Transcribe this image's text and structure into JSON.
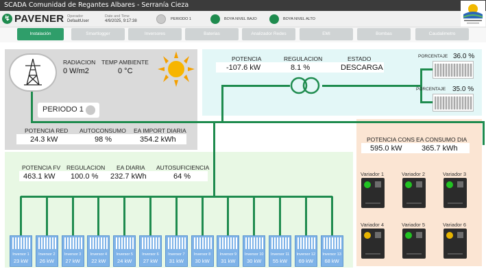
{
  "window_title": "SCADA Comunidad de Regantes Albares - Serranía Cieza",
  "logo": "PAVENER",
  "operator": {
    "label": "Operador",
    "value": "DefaultUser"
  },
  "datetime": {
    "label": "Date and Time",
    "value": "4/9/2025, 9:17:38"
  },
  "indicators": [
    {
      "label": "PERIODO 1",
      "color": "#c9c9c9"
    },
    {
      "label": "BOYA NIVEL BAJO",
      "color": "#1e8b4e"
    },
    {
      "label": "BOYA NIVEL ALTO",
      "color": "#1e8b4e"
    }
  ],
  "tabs": [
    "Instalación",
    "Smartlogger",
    "Inversores",
    "Baterias",
    "Analizador Redes",
    "EMI",
    "Bombas",
    "Caudalimetro"
  ],
  "weather": {
    "rad_label": "RADIACION",
    "rad_value": "0 W/m2",
    "temp_label": "TEMP AMBIENTE",
    "temp_value": "0 °C"
  },
  "periodo": "PERIODO 1",
  "grid": {
    "potencia_label": "POTENCIA RED",
    "potencia_value": "24.3 kW",
    "auto_label": "AUTOCONSUMO",
    "auto_value": "98 %",
    "import_label": "EA IMPORT DIARIA",
    "import_value": "354.2 kWh"
  },
  "battery": {
    "potencia_label": "POTENCIA",
    "potencia_value": "-107.6 kW",
    "regulacion_label": "REGULACION",
    "regulacion_value": "8.1 %",
    "estado_label": "ESTADO",
    "estado_value": "DESCARGA",
    "pct_label": "PORCENTAJE",
    "pct1": "36.0 %",
    "pct2": "35.0 %"
  },
  "fv": {
    "potencia_label": "POTENCIA FV",
    "potencia_value": "463.1 kW",
    "regulacion_label": "REGULACION",
    "regulacion_value": "100.0 %",
    "ea_label": "EA DIARIA",
    "ea_value": "232.7 kWh",
    "auto_label": "AUTOSUFICIENCIA",
    "auto_value": "64 %"
  },
  "cons": {
    "potencia_label": "POTENCIA CONS",
    "potencia_value": "595.0 kW",
    "ea_label": "EA CONSUMO DIA",
    "ea_value": "365.7 kWh"
  },
  "variadores": [
    {
      "label": "Variador 1",
      "led": "#22c322"
    },
    {
      "label": "Variador 2",
      "led": "#22c322"
    },
    {
      "label": "Variador 3",
      "led": "#22c322"
    },
    {
      "label": "Variador 4",
      "led": "#e8b400"
    },
    {
      "label": "Variador 5",
      "led": "#22c322"
    },
    {
      "label": "Variador 6",
      "led": "#e8b400"
    }
  ],
  "inversores": [
    {
      "name": "Inversor 1",
      "power": "23 kW"
    },
    {
      "name": "Inversor 2",
      "power": "26 kW"
    },
    {
      "name": "Inversor 3",
      "power": "27 kW"
    },
    {
      "name": "Inversor 4",
      "power": "22 kW"
    },
    {
      "name": "Inversor 5",
      "power": "24 kW"
    },
    {
      "name": "Inversor 6",
      "power": "27 kW"
    },
    {
      "name": "Inversor 7",
      "power": "31 kW"
    },
    {
      "name": "Inversor 8",
      "power": "30 kW"
    },
    {
      "name": "Inversor 9",
      "power": "31 kW"
    },
    {
      "name": "Inversor 10",
      "power": "30 kW"
    },
    {
      "name": "Inversor 11",
      "power": "55 kW"
    },
    {
      "name": "Inversor 12",
      "power": "69 kW"
    },
    {
      "name": "Inversor 13",
      "power": "68 kW"
    }
  ],
  "colors": {
    "green": "#1e8b4e",
    "accent_tab": "#2f9e6a",
    "battery_panel": "#e3f7f7",
    "cons_panel": "#fbe5d3",
    "fv_panel": "#e8f8e4",
    "grid_panel": "#dadada"
  }
}
